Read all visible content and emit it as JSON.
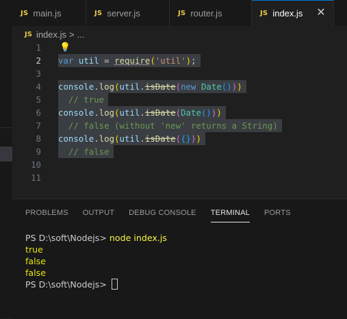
{
  "tabs": [
    {
      "icon": "JS",
      "label": "main.js"
    },
    {
      "icon": "JS",
      "label": "server.js"
    },
    {
      "icon": "JS",
      "label": "router.js"
    },
    {
      "icon": "JS",
      "label": "index.js",
      "active": true,
      "close": "✕"
    }
  ],
  "breadcrumb": {
    "icon": "JS",
    "file": "index.js",
    "separator": ">",
    "more": "..."
  },
  "editor": {
    "line_numbers": [
      "1",
      "2",
      "3",
      "4",
      "5",
      "6",
      "7",
      "8",
      "9",
      "10",
      "11"
    ],
    "current_line": "2",
    "lines": {
      "l2": {
        "kw": "var",
        "name": "util",
        "eq": "=",
        "fn": "require",
        "open": "(",
        "arg": "'util'",
        "close": ")",
        "semi": ";"
      },
      "l4": {
        "obj": "console",
        "dot": ".",
        "fn": "log",
        "o1": "(",
        "util": "util",
        "dot2": ".",
        "method": "isDate",
        "o2": "(",
        "kw": "new",
        "cls": "Date",
        "o3": "()",
        "c2": ")",
        "c1": ")"
      },
      "l5": {
        "comment": "// true"
      },
      "l6": {
        "obj": "console",
        "dot": ".",
        "fn": "log",
        "o1": "(",
        "util": "util",
        "dot2": ".",
        "method": "isDate",
        "o2": "(",
        "cls": "Date",
        "o3": "()",
        "c2": ")",
        "c1": ")"
      },
      "l7": {
        "comment": "// false (without 'new' returns a String)"
      },
      "l8": {
        "obj": "console",
        "dot": ".",
        "fn": "log",
        "o1": "(",
        "util": "util",
        "dot2": ".",
        "method": "isDate",
        "o2": "(",
        "o3": "{}",
        "c2": ")",
        "c1": ")"
      },
      "l9": {
        "comment": "// false"
      }
    }
  },
  "panel": {
    "tabs": [
      "PROBLEMS",
      "OUTPUT",
      "DEBUG CONSOLE",
      "TERMINAL",
      "PORTS"
    ],
    "active_tab": "TERMINAL"
  },
  "terminal": {
    "prompt": "PS D:\\soft\\Nodejs> ",
    "command": "node index.js",
    "outputs": [
      "true",
      "false",
      "false"
    ],
    "prompt2": "PS D:\\soft\\Nodejs> "
  },
  "colors": {
    "accent": "#0078d4",
    "editor_bg": "#1f1f1f",
    "js_icon": "#e8c84a"
  }
}
